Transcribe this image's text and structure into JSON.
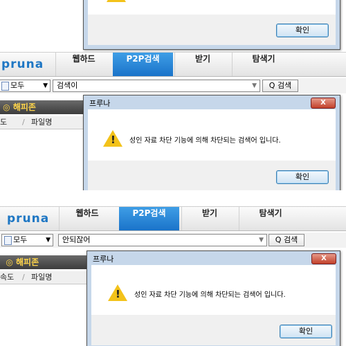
{
  "dialog": {
    "title": "프루나",
    "message": "성인 자료 차단 기능에 의해 차단되는 검색어 입니다.",
    "ok_label": "확인",
    "close_glyph": "X",
    "warning_glyph": "!"
  },
  "app": {
    "logo": "pruna",
    "tabs": [
      "웹하드",
      "P2P검색",
      "받기",
      "탐색기"
    ],
    "active_tab": "P2P검색",
    "category": "모두",
    "search_button": "검색",
    "zone_label": "해피존",
    "columns": [
      "도",
      "파일명"
    ]
  },
  "panels": [
    {
      "search_query": "검색이",
      "columns": [
        "도",
        "파일명"
      ]
    },
    {
      "search_query": "안되잖어",
      "columns": [
        "속도",
        "파일명"
      ]
    }
  ],
  "colors": {
    "accent": "#1a73c9",
    "logo": "#1f77c4",
    "zone_text": "#ffd54a"
  }
}
